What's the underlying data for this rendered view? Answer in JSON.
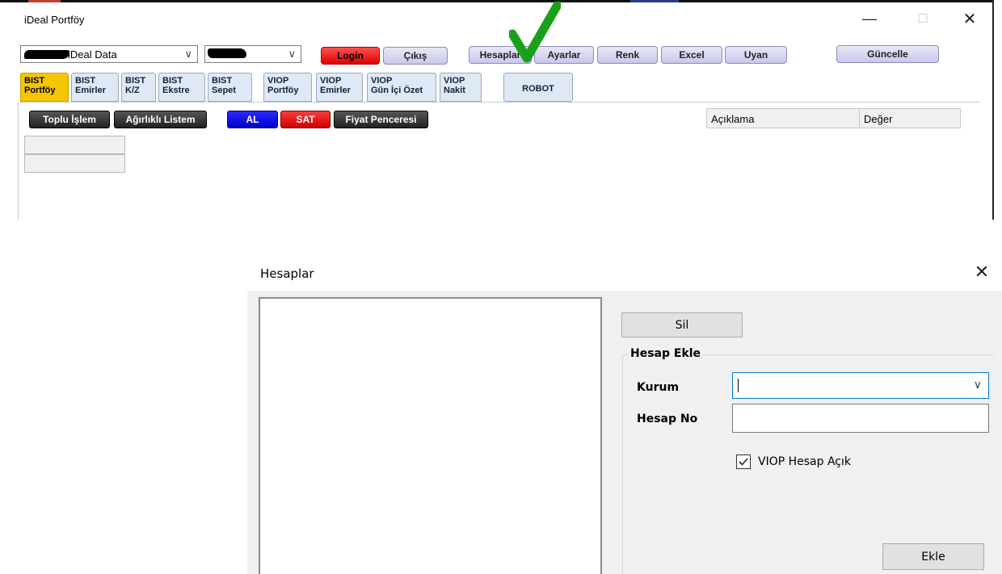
{
  "main_window": {
    "title": "iDeal Portföy",
    "controls": {
      "minimize": "—",
      "maximize": "☐",
      "close": "✕"
    },
    "data_source_combo": {
      "value": "iDeal Data"
    },
    "account_combo": {
      "value": ""
    },
    "buttons": {
      "login": "Login",
      "cikis": "Çıkış",
      "hesaplar": "Hesaplar",
      "ayarlar": "Ayarlar",
      "renk": "Renk",
      "excel": "Excel",
      "uyan": "Uyan",
      "guncelle": "Güncelle"
    },
    "check_color": "#1aa11a",
    "tabs": [
      {
        "line1": "BIST",
        "line2": "Portföy"
      },
      {
        "line1": "BIST",
        "line2": "Emirler"
      },
      {
        "line1": "BIST",
        "line2": "K/Z"
      },
      {
        "line1": "BIST",
        "line2": "Ekstre"
      },
      {
        "line1": "BIST",
        "line2": "Sepet"
      },
      {
        "line1": "VIOP",
        "line2": "Portföy"
      },
      {
        "line1": "VIOP",
        "line2": "Emirler"
      },
      {
        "line1": "VIOP",
        "line2": "Gün İçi Özet"
      },
      {
        "line1": "VIOP",
        "line2": "Nakit"
      }
    ],
    "robot_tab": "ROBOT",
    "action_buttons": {
      "toplu_islem": "Toplu İşlem",
      "agirlikli_listem": "Ağırlıklı Listem",
      "al": "AL",
      "sat": "SAT",
      "fiyat_penceresi": "Fiyat Penceresi"
    },
    "desc_table": {
      "col_aciklama": "Açıklama",
      "col_deger": "Değer"
    }
  },
  "dialog": {
    "title": "Hesaplar",
    "close": "✕",
    "sil_button": "Sil",
    "group_title": "Hesap Ekle",
    "kurum_label": "Kurum",
    "kurum_value": "",
    "hesap_no_label": "Hesap No",
    "hesap_no_value": "",
    "viop_checkbox_label": "VIOP Hesap Açık",
    "viop_checked": true,
    "ekle_button": "Ekle"
  }
}
